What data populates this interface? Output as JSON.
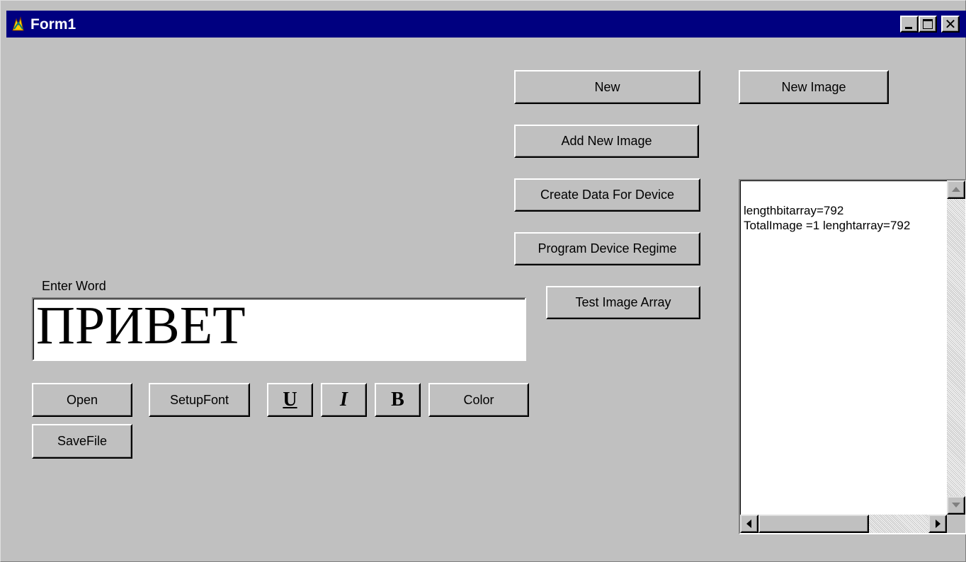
{
  "window": {
    "title": "Form1",
    "icon": "app-icon",
    "controls": [
      "minimize-icon",
      "maximize-icon",
      "close-icon"
    ],
    "close_glyph": "✕"
  },
  "buttons": {
    "new": "New",
    "new_image": "New Image",
    "add_new_image": "Add New Image",
    "create_data_for_device": "Create Data For Device",
    "program_device_regime": "Program Device Regime",
    "test_image_array": "Test Image Array",
    "open": "Open",
    "setup_font": "SetupFont",
    "underline": "U",
    "italic": "I",
    "bold": "B",
    "color": "Color",
    "save_file": "SaveFile"
  },
  "word_input": {
    "label": "Enter Word",
    "value": "ПРИВЕТ"
  },
  "memo": {
    "lines": [
      "lengthbitarray=792",
      "TotalImage =1 lenghtarray=792"
    ]
  },
  "colors": {
    "face": "#c0c0c0",
    "titlebar": "#000080",
    "highlight": "#ffffff",
    "shadow": "#808080"
  }
}
